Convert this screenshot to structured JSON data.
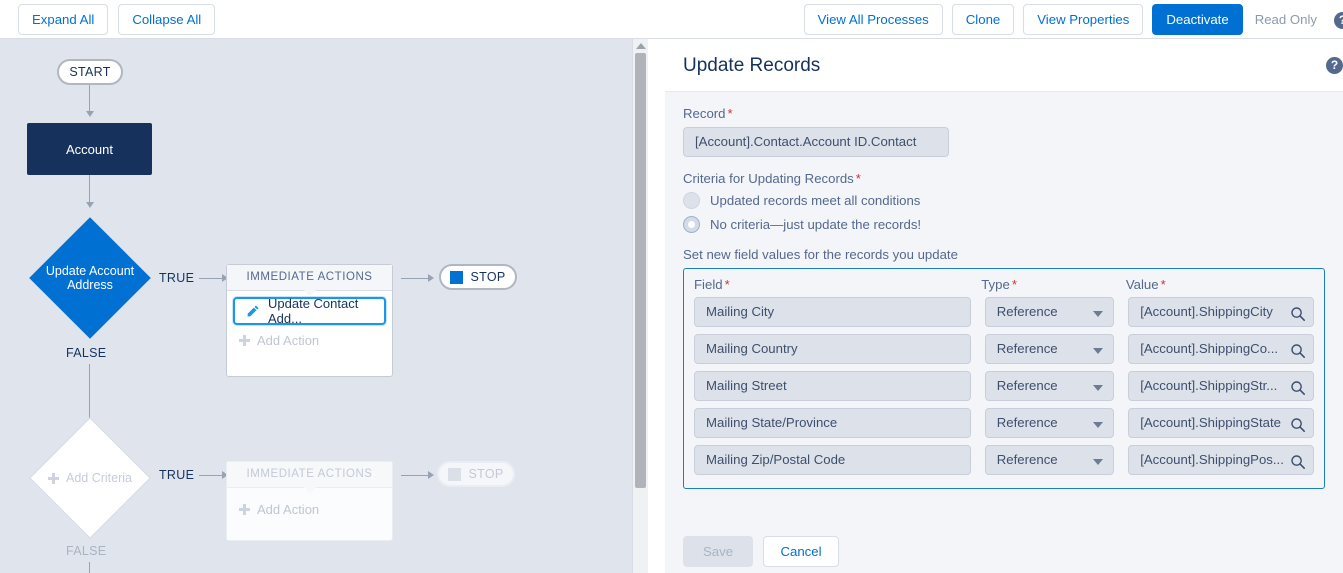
{
  "toolbar": {
    "expand_all": "Expand All",
    "collapse_all": "Collapse All",
    "view_all_processes": "View All Processes",
    "clone": "Clone",
    "view_properties": "View Properties",
    "deactivate": "Deactivate",
    "read_only": "Read Only",
    "help_glyph": "?",
    "brand_color": "#0070d2",
    "link_color": "#0070d2"
  },
  "canvas": {
    "start_label": "START",
    "object_node_label": "Account",
    "criteria_1": {
      "label": "Update Account\nAddress",
      "label_line1": "Update Account",
      "label_line2": "Address",
      "true_label": "TRUE",
      "false_label": "FALSE",
      "actions_header": "IMMEDIATE ACTIONS",
      "action_label": "Update Contact Add...",
      "add_action_label": "Add Action",
      "stop_label": "STOP",
      "color": "#0070d2"
    },
    "criteria_2": {
      "label": "Add Criteria",
      "true_label": "TRUE",
      "false_label": "FALSE",
      "actions_header": "IMMEDIATE ACTIONS",
      "add_action_label": "Add Action",
      "stop_label": "STOP"
    }
  },
  "panel": {
    "title": "Update Records",
    "help_glyph": "?",
    "record_label": "Record",
    "record_value": "[Account].Contact.Account ID.Contact",
    "criteria_label": "Criteria for Updating Records",
    "criteria_options": [
      {
        "label": "Updated records meet all conditions",
        "selected": false
      },
      {
        "label": "No criteria—just update the records!",
        "selected": true
      }
    ],
    "set_values_label": "Set new field values for the records you update",
    "grid": {
      "headers": [
        "Field",
        "Type",
        "Value"
      ],
      "rows": [
        {
          "field": "Mailing City",
          "type": "Reference",
          "value": "[Account].ShippingCity"
        },
        {
          "field": "Mailing Country",
          "type": "Reference",
          "value": "[Account].ShippingCo..."
        },
        {
          "field": "Mailing Street",
          "type": "Reference",
          "value": "[Account].ShippingStr..."
        },
        {
          "field": "Mailing State/Province",
          "type": "Reference",
          "value": "[Account].ShippingState"
        },
        {
          "field": "Mailing Zip/Postal Code",
          "type": "Reference",
          "value": "[Account].ShippingPos..."
        }
      ]
    },
    "save_label": "Save",
    "cancel_label": "Cancel",
    "required_marker": "*"
  }
}
